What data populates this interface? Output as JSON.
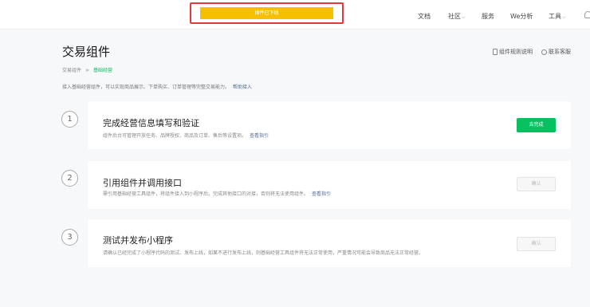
{
  "topbar": {
    "banner_text": "插件已下线",
    "nav": [
      {
        "label": "文档",
        "dropdown": false
      },
      {
        "label": "社区",
        "dropdown": true
      },
      {
        "label": "服务",
        "dropdown": false
      },
      {
        "label": "We分析",
        "dropdown": false
      },
      {
        "label": "工具",
        "dropdown": true
      }
    ]
  },
  "page": {
    "title": "交易组件",
    "links": {
      "rules": "组件规则说明",
      "support": "联系客服"
    },
    "breadcrumb": [
      "交易组件",
      "基础经营"
    ],
    "breadcrumb_sep": ">",
    "description": "接入基础经营组件，可以实现商品展示、下单购买、订单管理等完整交易能力。",
    "description_link": "帮助接入"
  },
  "steps": [
    {
      "number": "1",
      "title": "完成经营信息填写和验证",
      "desc": "组件后台可管理开放任务、品牌授权、商品及订单、售后等设置项。",
      "link": "查看指引",
      "button": "去完成",
      "enabled": true
    },
    {
      "number": "2",
      "title": "引用组件并调用接口",
      "desc": "需引用基础经营工具组件，将组件接入到小程序后，完成其他接口的对接，否则将无法使用组件。",
      "link": "查看指引",
      "button": "确认",
      "enabled": false
    },
    {
      "number": "3",
      "title": "测试并发布小程序",
      "desc": "请确认已经完成了小程序代码的测试、发布上线，如果不进行发布上线，则基础经营工具组件将无法正常使用，严重情况可能会导致商品无法正常经营。",
      "link": "",
      "button": "确认",
      "enabled": false
    }
  ],
  "colors": {
    "accent": "#07c160",
    "banner": "#f6c000",
    "highlight_frame": "#e5393d",
    "link": "#576b95"
  }
}
